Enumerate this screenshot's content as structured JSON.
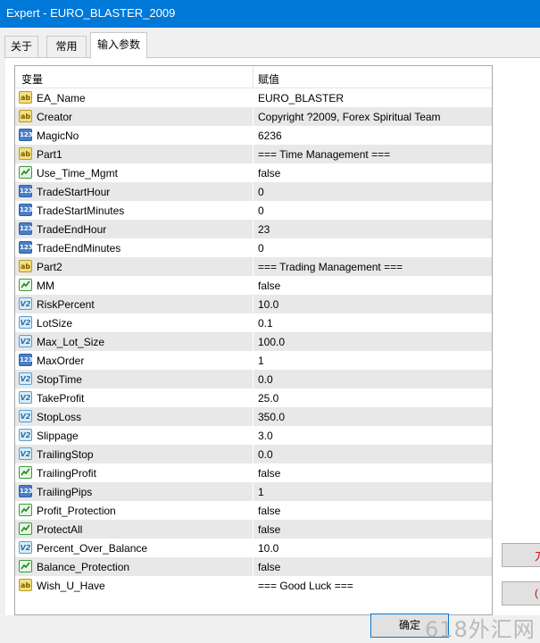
{
  "window": {
    "title": "Expert - EURO_BLASTER_2009"
  },
  "tabs": [
    {
      "label": "关于"
    },
    {
      "label": "常用"
    },
    {
      "label": "输入参数"
    }
  ],
  "table": {
    "headers": {
      "variable": "变量",
      "value": "赋值"
    },
    "rows": [
      {
        "icon": "string-icon",
        "name": "EA_Name",
        "value": "EURO_BLASTER"
      },
      {
        "icon": "string-icon",
        "name": "Creator",
        "value": "Copyright ?2009, Forex Spiritual Team"
      },
      {
        "icon": "integer-icon",
        "name": "MagicNo",
        "value": "6236"
      },
      {
        "icon": "string-icon",
        "name": "Part1",
        "value": "=== Time Management ==="
      },
      {
        "icon": "boolean-icon",
        "name": "Use_Time_Mgmt",
        "value": "false"
      },
      {
        "icon": "integer-icon",
        "name": "TradeStartHour",
        "value": "0"
      },
      {
        "icon": "integer-icon",
        "name": "TradeStartMinutes",
        "value": "0"
      },
      {
        "icon": "integer-icon",
        "name": "TradeEndHour",
        "value": "23"
      },
      {
        "icon": "integer-icon",
        "name": "TradeEndMinutes",
        "value": "0"
      },
      {
        "icon": "string-icon",
        "name": "Part2",
        "value": "=== Trading Management ==="
      },
      {
        "icon": "boolean-icon",
        "name": "MM",
        "value": "false"
      },
      {
        "icon": "double-icon",
        "name": "RiskPercent",
        "value": "10.0"
      },
      {
        "icon": "double-icon",
        "name": "LotSize",
        "value": "0.1"
      },
      {
        "icon": "double-icon",
        "name": "Max_Lot_Size",
        "value": "100.0"
      },
      {
        "icon": "integer-icon",
        "name": "MaxOrder",
        "value": "1"
      },
      {
        "icon": "double-icon",
        "name": "StopTime",
        "value": "0.0"
      },
      {
        "icon": "double-icon",
        "name": "TakeProfit",
        "value": "25.0"
      },
      {
        "icon": "double-icon",
        "name": "StopLoss",
        "value": "350.0"
      },
      {
        "icon": "double-icon",
        "name": "Slippage",
        "value": "3.0"
      },
      {
        "icon": "double-icon",
        "name": "TrailingStop",
        "value": "0.0"
      },
      {
        "icon": "boolean-icon",
        "name": "TrailingProfit",
        "value": "false"
      },
      {
        "icon": "integer-icon",
        "name": "TrailingPips",
        "value": "1"
      },
      {
        "icon": "boolean-icon",
        "name": "Profit_Protection",
        "value": "false"
      },
      {
        "icon": "boolean-icon",
        "name": "ProtectAll",
        "value": "false"
      },
      {
        "icon": "double-icon",
        "name": "Percent_Over_Balance",
        "value": "10.0"
      },
      {
        "icon": "boolean-icon",
        "name": "Balance_Protection",
        "value": "false"
      },
      {
        "icon": "string-icon",
        "name": "Wish_U_Have",
        "value": "=== Good Luck ==="
      }
    ]
  },
  "buttons": {
    "ok_label": "确定",
    "side1_label": "刀",
    "side2_label": "("
  },
  "watermark": "618外汇网"
}
